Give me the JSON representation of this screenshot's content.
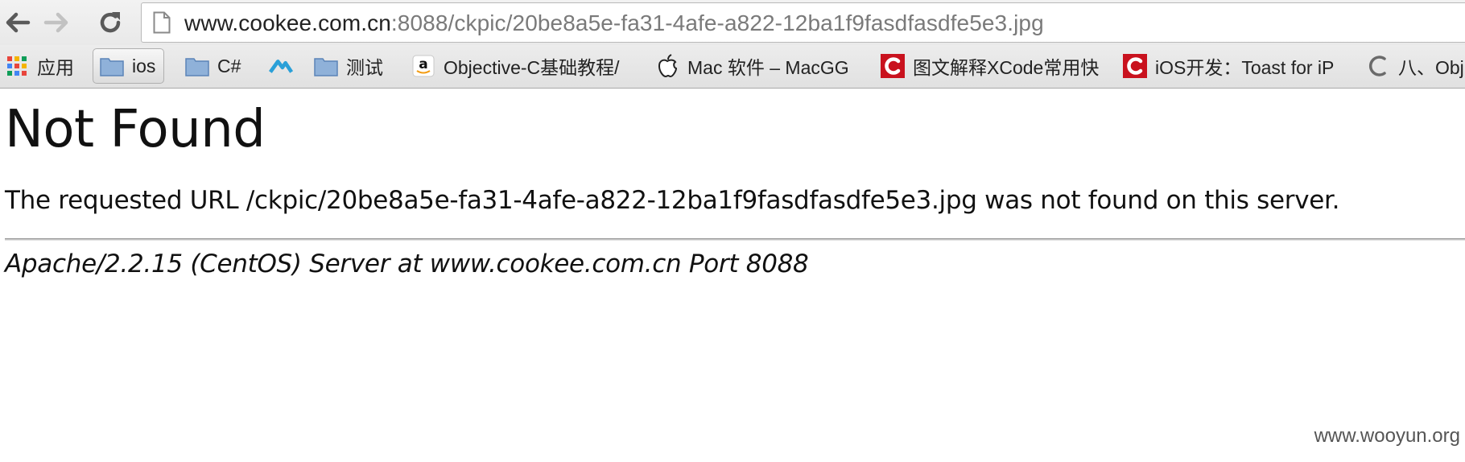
{
  "browser": {
    "back_icon": "arrow-left-icon",
    "forward_icon": "arrow-right-icon",
    "reload_icon": "reload-icon",
    "page_icon": "document-icon",
    "url_host": "www.cookee.com.cn",
    "url_path": ":8088/ckpic/20be8a5e-fa31-4afe-a822-12ba1f9fasdfasdfe5e3.jpg"
  },
  "bookmarks": [
    {
      "label": "应用",
      "icon": "apps-grid-icon"
    },
    {
      "label": "ios",
      "icon": "folder-icon",
      "selected": true
    },
    {
      "label": "C#",
      "icon": "folder-icon"
    },
    {
      "label": "",
      "icon": "blue-logo-icon"
    },
    {
      "label": "测试",
      "icon": "folder-icon"
    },
    {
      "label": "Objective-C基础教程/",
      "icon": "amazon-icon"
    },
    {
      "label": "Mac 软件 – MacGG",
      "icon": "apple-icon"
    },
    {
      "label": "图文解释XCode常用快",
      "icon": "csdn-icon"
    },
    {
      "label": "iOS开发：Toast for iP",
      "icon": "csdn-icon"
    },
    {
      "label": "八、Obj",
      "icon": "c-logo-icon"
    }
  ],
  "page": {
    "title": "Not Found",
    "message": "The requested URL /ckpic/20be8a5e-fa31-4afe-a822-12ba1f9fasdfasdfe5e3.jpg was not found on this server.",
    "address": "Apache/2.2.15 (CentOS) Server at www.cookee.com.cn Port 8088"
  },
  "watermark": "www.wooyun.org",
  "colors": {
    "folder_blue": "#8fb1d9",
    "csdn_red": "#c9121e",
    "logo_blue": "#2aa0d8"
  }
}
